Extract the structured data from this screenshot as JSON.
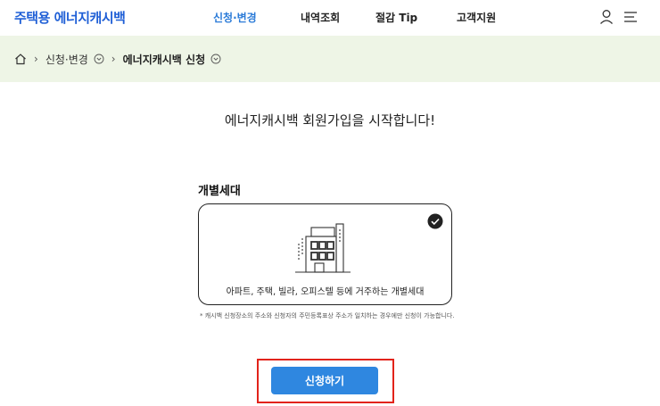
{
  "header": {
    "logo": "주택용 에너지캐시백",
    "nav": [
      {
        "label": "신청·변경"
      },
      {
        "label": "내역조회"
      },
      {
        "label": "절감 Tip"
      },
      {
        "label": "고객지원"
      }
    ],
    "icons": [
      "user-icon",
      "menu-icon"
    ],
    "accent_color": "#2b7bd8"
  },
  "breadcrumb": {
    "items": [
      "신청·변경",
      "에너지캐시백 신청"
    ],
    "background": "#eef5e6"
  },
  "main": {
    "headline": "에너지캐시백 회원가입을 시작합니다!",
    "section_title": "개별세대",
    "card": {
      "label": "아파트, 주택, 빌라, 오피스텔 등에 거주하는 개별세대",
      "selected": true,
      "icons": [
        "building-icon",
        "check-circle-icon"
      ]
    },
    "note": "* 캐시백 신청장소의 주소와 신청자의 주민등록표상 주소가 일치하는 경우에만 신청이 가능합니다.",
    "apply_button": "신청하기",
    "button_color": "#2f87e0",
    "highlight_color": "#e2231a"
  }
}
